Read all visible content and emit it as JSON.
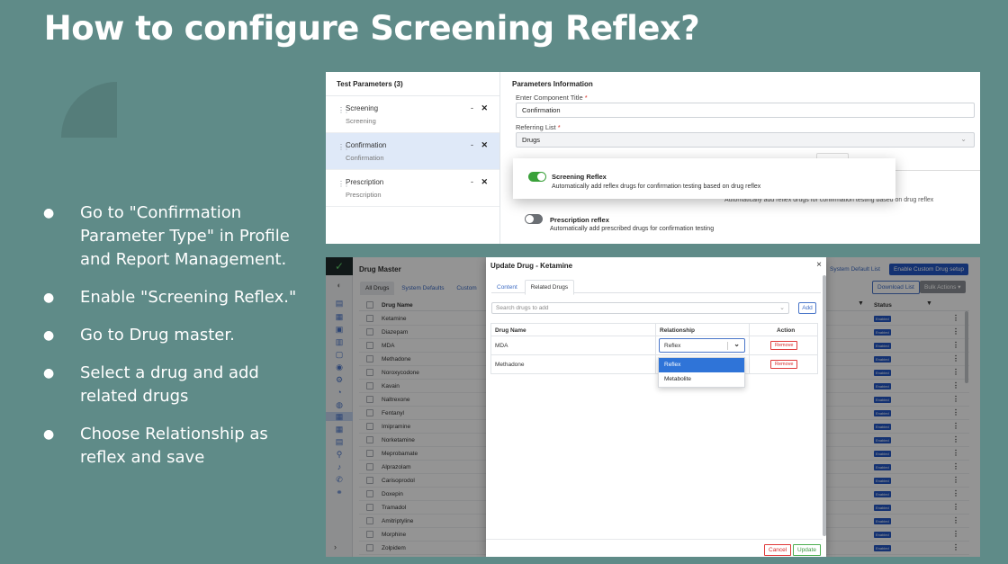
{
  "slide": {
    "title": "How to configure Screening Reflex?",
    "bullets": [
      "Go to \"Confirmation Parameter Type\" in Profile and Report Management.",
      "Enable \"Screening Reflex.\"",
      "Go to Drug master.",
      "Select a drug and add related drugs",
      "Choose Relationship as reflex and save"
    ]
  },
  "params_panel": {
    "header": "Test Parameters (3)",
    "items": [
      {
        "name": "Screening",
        "sub": "Screening",
        "active": false
      },
      {
        "name": "Confirmation",
        "sub": "Confirmation",
        "active": true
      },
      {
        "name": "Prescription",
        "sub": "Prescription",
        "active": false
      }
    ],
    "minus": "-",
    "close": "✕"
  },
  "params_info": {
    "header": "Parameters Information",
    "title_label": "Enter Component Title",
    "required": "*",
    "title_value": "Confirmation",
    "list_label": "Referring List",
    "list_value": "Drugs",
    "screening_reflex": {
      "title": "Screening Reflex",
      "desc": "Automatically add reflex drugs for confirmation testing based on drug reflex",
      "enabled": true
    },
    "faded_desc": "Automatically add reflex drugs for confirmation testing based on drug reflex",
    "prescription_reflex": {
      "title": "Prescription reflex",
      "desc": "Automatically add prescribed drugs for confirmation testing",
      "enabled": false
    }
  },
  "drug_master": {
    "title": "Drug Master",
    "tabs": [
      "All Drugs",
      "System Defaults",
      "Custom"
    ],
    "btn_default_list": "System Default List",
    "btn_enable_custom": "Enable Custom Drug setup",
    "btn_download": "Download List",
    "btn_bulk": "Bulk Actions",
    "columns": {
      "drug_name": "Drug Name",
      "status": "Status"
    },
    "status_label": "Enabled",
    "rows": [
      "Ketamine",
      "Diazepam",
      "MDA",
      "Methadone",
      "Noroxycodone",
      "Kavain",
      "Naltrexone",
      "Fentanyl",
      "Imipramine",
      "Norketamine",
      "Meprobamate",
      "Alprazolam",
      "Carisoprodol",
      "Doxepin",
      "Tramadol",
      "Amitriptyline",
      "Morphine",
      "Zolpidem"
    ]
  },
  "modal": {
    "title": "Update Drug - Ketamine",
    "close": "×",
    "tabs": [
      "Content",
      "Related Drugs"
    ],
    "search_placeholder": "Search drugs to add",
    "add_label": "Add",
    "columns": [
      "Drug Name",
      "Relationship",
      "Action"
    ],
    "rows": [
      {
        "drug": "MDA",
        "relationship": "Reflex",
        "action": "Remove"
      },
      {
        "drug": "Methadone",
        "relationship": "",
        "action": "Remove"
      }
    ],
    "dropdown_options": [
      "Reflex",
      "Metabolite"
    ],
    "cancel_label": "Cancel",
    "update_label": "Update"
  },
  "colors": {
    "background": "#5f8b88",
    "primary": "#2457c5",
    "toggle_on": "#3aa13a",
    "danger": "#d62828",
    "success": "#3e9a42"
  }
}
